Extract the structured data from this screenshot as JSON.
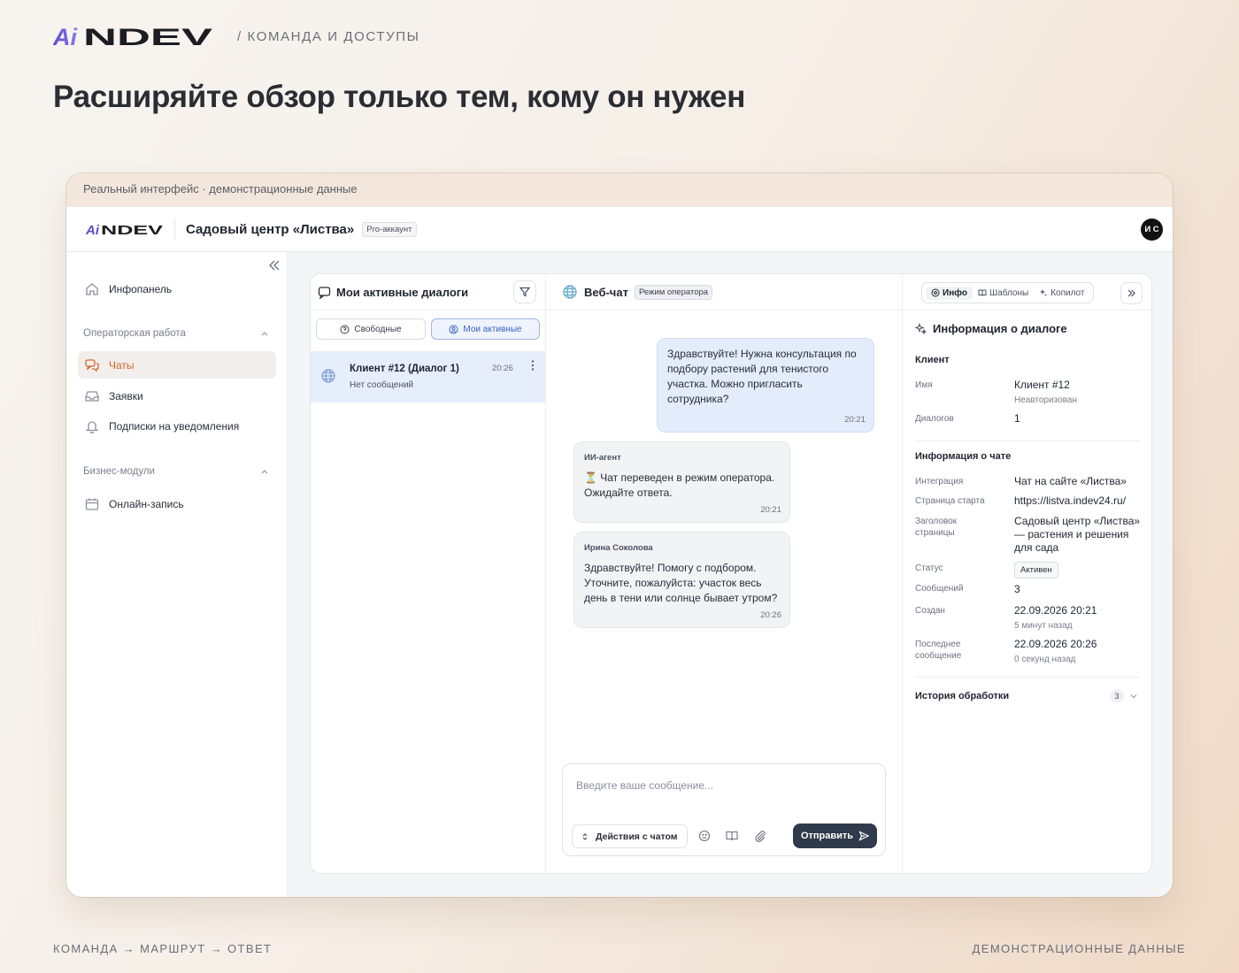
{
  "brand": {
    "logo_text": "AiNDEV",
    "section": "/ КОМАНДА И ДОСТУПЫ"
  },
  "headline": "Расширяйте обзор только тем, кому он нужен",
  "frame_caption": "Реальный интерфейс · демонстрационные данные",
  "app": {
    "org_name": "Садовый центр «Листва»",
    "plan_badge": "Pro-аккаунт",
    "user_initials": "И С"
  },
  "sidebar": {
    "dashboard": "Инфопанель",
    "group_operator": "Операторская работа",
    "chats": "Чаты",
    "requests": "Заявки",
    "subscriptions": "Подписки на уведомления",
    "group_business": "Бизнес-модули",
    "booking": "Онлайн-запись"
  },
  "dialogs": {
    "title": "Мои активные диалоги",
    "seg_free": "Свободные",
    "seg_mine": "Мои активные",
    "items": [
      {
        "name": "Клиент #12 (Диалог 1)",
        "preview": "Нет сообщений",
        "time": "20:26"
      }
    ]
  },
  "chat": {
    "title": "Веб-чат",
    "mode": "Режим оператора",
    "messages": [
      {
        "author": "",
        "text": "Здравствуйте! Нужна консультация по подбору растений для тенистого участка. Можно пригласить сотрудника?",
        "time": "20:21"
      },
      {
        "author": "ИИ-агент",
        "text": "⏳ Чат переведен в режим оператора. Ожидайте ответа.",
        "time": "20:21"
      },
      {
        "author": "Ирина Соколова",
        "text": "Здравствуйте! Помогу с подбором. Уточните, пожалуйста: участок весь день в тени или солнце бывает утром?",
        "time": "20:26"
      }
    ],
    "input_placeholder": "Введите ваше сообщение...",
    "actions_label": "Действия с чатом",
    "send_label": "Отправить"
  },
  "info": {
    "tabs": [
      "Инфо",
      "Шаблоны",
      "Копилот"
    ],
    "title": "Информация о диалоге",
    "client_section": "Клиент",
    "name_label": "Имя",
    "name_value": "Клиент #12",
    "name_sub": "Неавторизован",
    "dialogs_label": "Диалогов",
    "dialogs_value": "1",
    "chat_section": "Информация о чате",
    "integration_label": "Интеграция",
    "integration_value": "Чат на сайте «Листва»",
    "start_page_label": "Страница старта",
    "start_page_value": "https://listva.indev24.ru/",
    "page_title_label": "Заголовок страницы",
    "page_title_value": "Садовый центр «Листва» — растения и решения для сада",
    "status_label": "Статус",
    "status_value": "Активен",
    "messages_label": "Сообщений",
    "messages_value": "3",
    "created_label": "Создан",
    "created_value": "22.09.2026 20:21",
    "created_sub": "5 минут назад",
    "last_label": "Последнее сообщение",
    "last_value": "22.09.2026 20:26",
    "last_sub": "0 секунд назад",
    "history_label": "История обработки",
    "history_count": "3"
  },
  "footer": {
    "left": "КОМАНДА → МАРШРУТ → ОТВЕТ",
    "right": "ДЕМОНСТРАЦИОННЫЕ ДАННЫЕ"
  },
  "colors": {
    "accent": "#d0692a",
    "brand_purple": "#6b56d6",
    "send_button": "#2f3a4a",
    "active_dialog": "#e6eefb"
  }
}
